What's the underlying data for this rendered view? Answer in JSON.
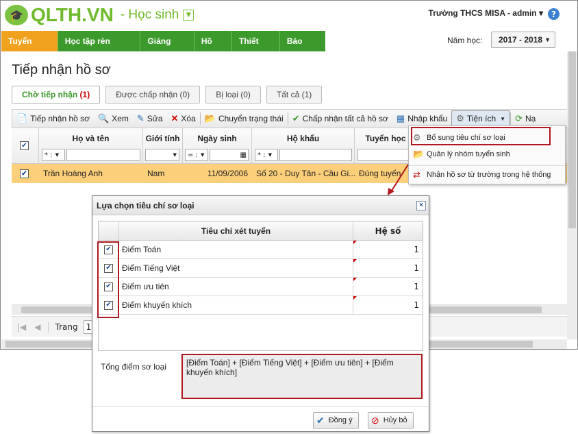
{
  "header": {
    "logo_text": "QLTH.VN",
    "logo_sub": "- Học sinh",
    "school_user": "Trường THCS MISA - admin ▾",
    "help": "?"
  },
  "nav": {
    "items": [
      "Tuyển sinh",
      "Học tập rèn luyện",
      "Giảng dạy",
      "Hồ sơ",
      "Thiết lập",
      "Báo cáo"
    ],
    "active_index": 0
  },
  "year": {
    "label": "Năm học:",
    "value": "2017 - 2018"
  },
  "page_title": "Tiếp nhận hồ sơ",
  "tabs": [
    {
      "label": "Chờ tiếp nhận",
      "count": "(1)"
    },
    {
      "label": "Được chấp nhận",
      "count": "(0)"
    },
    {
      "label": "Bị loại",
      "count": "(0)"
    },
    {
      "label": "Tất cả",
      "count": "(1)"
    }
  ],
  "toolbar": {
    "receive": "Tiếp nhận hồ sơ",
    "view": "Xem",
    "edit": "Sửa",
    "delete": "Xóa",
    "change_status": "Chuyển trạng thái",
    "accept_all": "Chấp nhận tất cả hồ sơ",
    "import": "Nhập khẩu",
    "utilities": "Tiện ích",
    "more": "Nạ"
  },
  "grid": {
    "headers": [
      "Họ và tên",
      "Giới tính",
      "Ngày sinh",
      "Hộ khẩu",
      "Tuyển học"
    ],
    "filters": {
      "name_op": "* :",
      "birth_op": "= :",
      "address_op": "* :"
    },
    "rows": [
      {
        "name": "Trần Hoàng Anh",
        "gender": "Nam",
        "birth": "11/09/2006",
        "address": "Số 20 - Duy Tân - Cầu Gi...",
        "admission": "Đúng tuyến"
      }
    ]
  },
  "pager": {
    "label": "Trang",
    "value": "1"
  },
  "context_menu": {
    "items": [
      "Bổ sung tiêu chí sơ loại",
      "Quản lý nhóm tuyển sinh",
      "Nhận hồ sơ từ trường trong hệ thống"
    ]
  },
  "dialog": {
    "title": "Lựa chọn tiêu chí sơ loại",
    "close": "×",
    "col_criteria": "Tiêu chí xét tuyển",
    "col_coef": "Hệ số",
    "rows": [
      {
        "name": "Điểm Toán",
        "coef": "1"
      },
      {
        "name": "Điểm Tiếng Việt",
        "coef": "1"
      },
      {
        "name": "Điểm ưu tiên",
        "coef": "1"
      },
      {
        "name": "Điểm khuyến khích",
        "coef": "1"
      }
    ],
    "total_label": "Tổng điểm sơ loại",
    "total_formula": "[Điểm Toán] + [Điểm Tiếng Việt] + [Điểm ưu tiên] + [Điểm khuyến khích]",
    "ok": "Đồng ý",
    "cancel": "Hủy bỏ"
  },
  "colors": {
    "brand_green": "#3c9a2c",
    "active_orange": "#f0a21e",
    "highlight_red": "#b0171e",
    "row_selected": "#fccf7a"
  }
}
